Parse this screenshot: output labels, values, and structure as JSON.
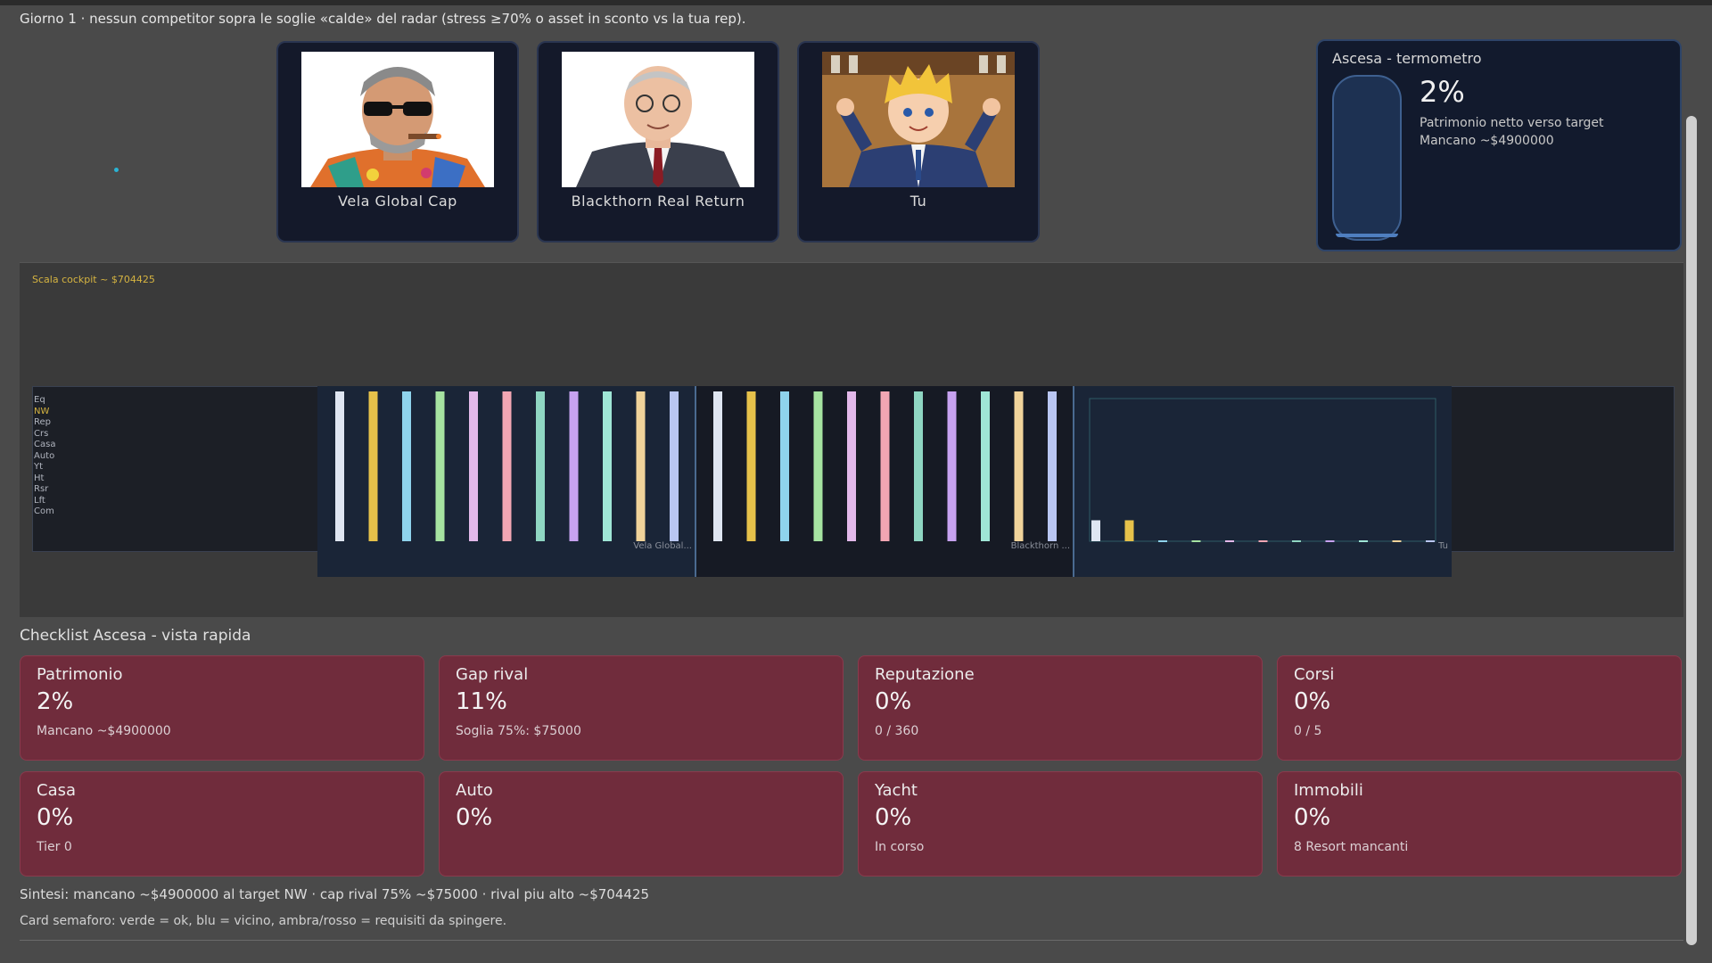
{
  "status_text": "Giorno 1 · nessun competitor sopra le soglie «calde» del radar (stress ≥70% o asset in sconto vs la tua rep).",
  "rivals": [
    {
      "name": "Vela Global Cap"
    },
    {
      "name": "Blackthorn Real Return"
    },
    {
      "name": "Tu"
    }
  ],
  "thermometer": {
    "title": "Ascesa - termometro",
    "percent_text": "2%",
    "fill_fraction": 0.02,
    "line1": "Patrimonio netto verso target",
    "line2": "Mancano ~$4900000"
  },
  "cockpit": {
    "scale_label": "Scala cockpit ~ $704425",
    "metric_labels": [
      "Eq",
      "NW",
      "Rep",
      "Crs",
      "Casa",
      "Auto",
      "Yt",
      "Ht",
      "Rsr",
      "Lft",
      "Com"
    ]
  },
  "chart_data": {
    "type": "bar",
    "categories": [
      "Eq",
      "NW",
      "Rep",
      "Crs",
      "Casa",
      "Auto",
      "Yt",
      "Ht",
      "Rsr",
      "Lft",
      "Com"
    ],
    "series": [
      {
        "name": "Vela Global...",
        "values": [
          1,
          1,
          1,
          1,
          1,
          1,
          1,
          1,
          1,
          1,
          1
        ]
      },
      {
        "name": "Blackthorn ...",
        "values": [
          1,
          1,
          1,
          1,
          1,
          1,
          1,
          1,
          1,
          1,
          1
        ]
      },
      {
        "name": "Tu",
        "values": [
          0.14,
          0.14,
          0,
          0,
          0,
          0,
          0,
          0,
          0,
          0,
          0
        ]
      }
    ],
    "ylim": [
      0,
      1
    ],
    "colors": [
      "#dfe6f2",
      "#e6c14a",
      "#8fd3ec",
      "#a6e3a1",
      "#e3b9ea",
      "#f2a6b3",
      "#8fd6c2",
      "#c7a2f0",
      "#9fe6d6",
      "#f0d39a",
      "#b9c6f2"
    ]
  },
  "checklist": {
    "title": "Checklist Ascesa - vista rapida",
    "cards": [
      {
        "label": "Patrimonio",
        "pct": "2%",
        "sub": "Mancano ~$4900000"
      },
      {
        "label": "Gap rival",
        "pct": "11%",
        "sub": "Soglia 75%: $75000"
      },
      {
        "label": "Reputazione",
        "pct": "0%",
        "sub": "0 / 360"
      },
      {
        "label": "Corsi",
        "pct": "0%",
        "sub": "0 / 5"
      },
      {
        "label": "Casa",
        "pct": "0%",
        "sub": "Tier 0"
      },
      {
        "label": "Auto",
        "pct": "0%",
        "sub": ""
      },
      {
        "label": "Yacht",
        "pct": "0%",
        "sub": "In corso"
      },
      {
        "label": "Immobili",
        "pct": "0%",
        "sub": "8 Resort mancanti"
      }
    ]
  },
  "summary": "Sintesi: mancano ~$4900000 al target NW · cap rival 75% ~$75000 · rival piu alto ~$704425",
  "legend_note": "Card semaforo: verde = ok, blu = vicino, ambra/rosso = requisiti da spingere.",
  "colors": {
    "card_red": "#702c3c",
    "panel_dark": "#14192a",
    "accent_gold": "#d6b441",
    "thermo_blue": "#1d3152"
  }
}
